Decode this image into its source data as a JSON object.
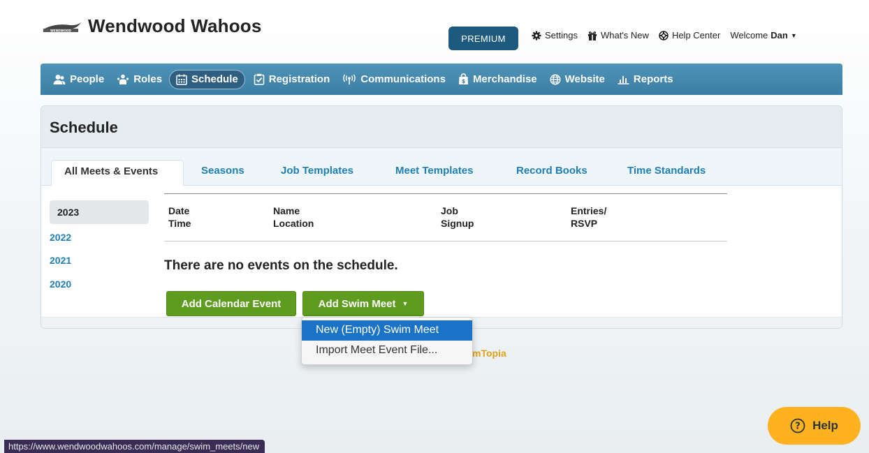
{
  "header": {
    "brand_logo_text": "WENDWOOD",
    "brand_title": "Wendwood Wahoos",
    "premium_label": "PREMIUM",
    "settings_label": "Settings",
    "whats_new_label": "What's New",
    "help_center_label": "Help Center",
    "welcome_label": "Welcome",
    "user_name": "Dan"
  },
  "nav": {
    "items": [
      {
        "label": "People",
        "icon": "people-icon"
      },
      {
        "label": "Roles",
        "icon": "roles-icon"
      },
      {
        "label": "Schedule",
        "icon": "calendar-icon"
      },
      {
        "label": "Registration",
        "icon": "clipboard-icon"
      },
      {
        "label": "Communications",
        "icon": "broadcast-icon"
      },
      {
        "label": "Merchandise",
        "icon": "shopping-bag-icon"
      },
      {
        "label": "Website",
        "icon": "globe-icon"
      },
      {
        "label": "Reports",
        "icon": "bar-chart-icon"
      }
    ],
    "active": "Schedule"
  },
  "panel": {
    "title": "Schedule",
    "tabs": [
      "All Meets & Events",
      "Seasons",
      "Job Templates",
      "Meet Templates",
      "Record Books",
      "Time Standards"
    ],
    "active_tab": "All Meets & Events",
    "years": [
      "2023",
      "2022",
      "2021",
      "2020"
    ],
    "active_year": "2023",
    "columns": {
      "date": "Date",
      "time": "Time",
      "name": "Name",
      "location": "Location",
      "job": "Job",
      "signup": "Signup",
      "entries": "Entries/",
      "rsvp": "RSVP"
    },
    "empty_message": "There are no events on the schedule.",
    "add_calendar_event_label": "Add Calendar Event",
    "add_swim_meet_label": "Add Swim Meet"
  },
  "dropdown": {
    "items": [
      "New (Empty) Swim Meet",
      "Import Meet Event File..."
    ],
    "active_item": "New (Empty) Swim Meet"
  },
  "powered_by_fragment": "mTopia",
  "help_button_label": "Help",
  "status_url": "https://www.wendwoodwahoos.com/manage/swim_meets/new",
  "colors": {
    "nav_bg": "#4586ab",
    "premium_bg": "#1e5a7e",
    "link_blue": "#1f7fb5",
    "button_green": "#5d9c1f",
    "dropdown_highlight": "#1b73c8",
    "help_orange": "#ffb21f"
  }
}
